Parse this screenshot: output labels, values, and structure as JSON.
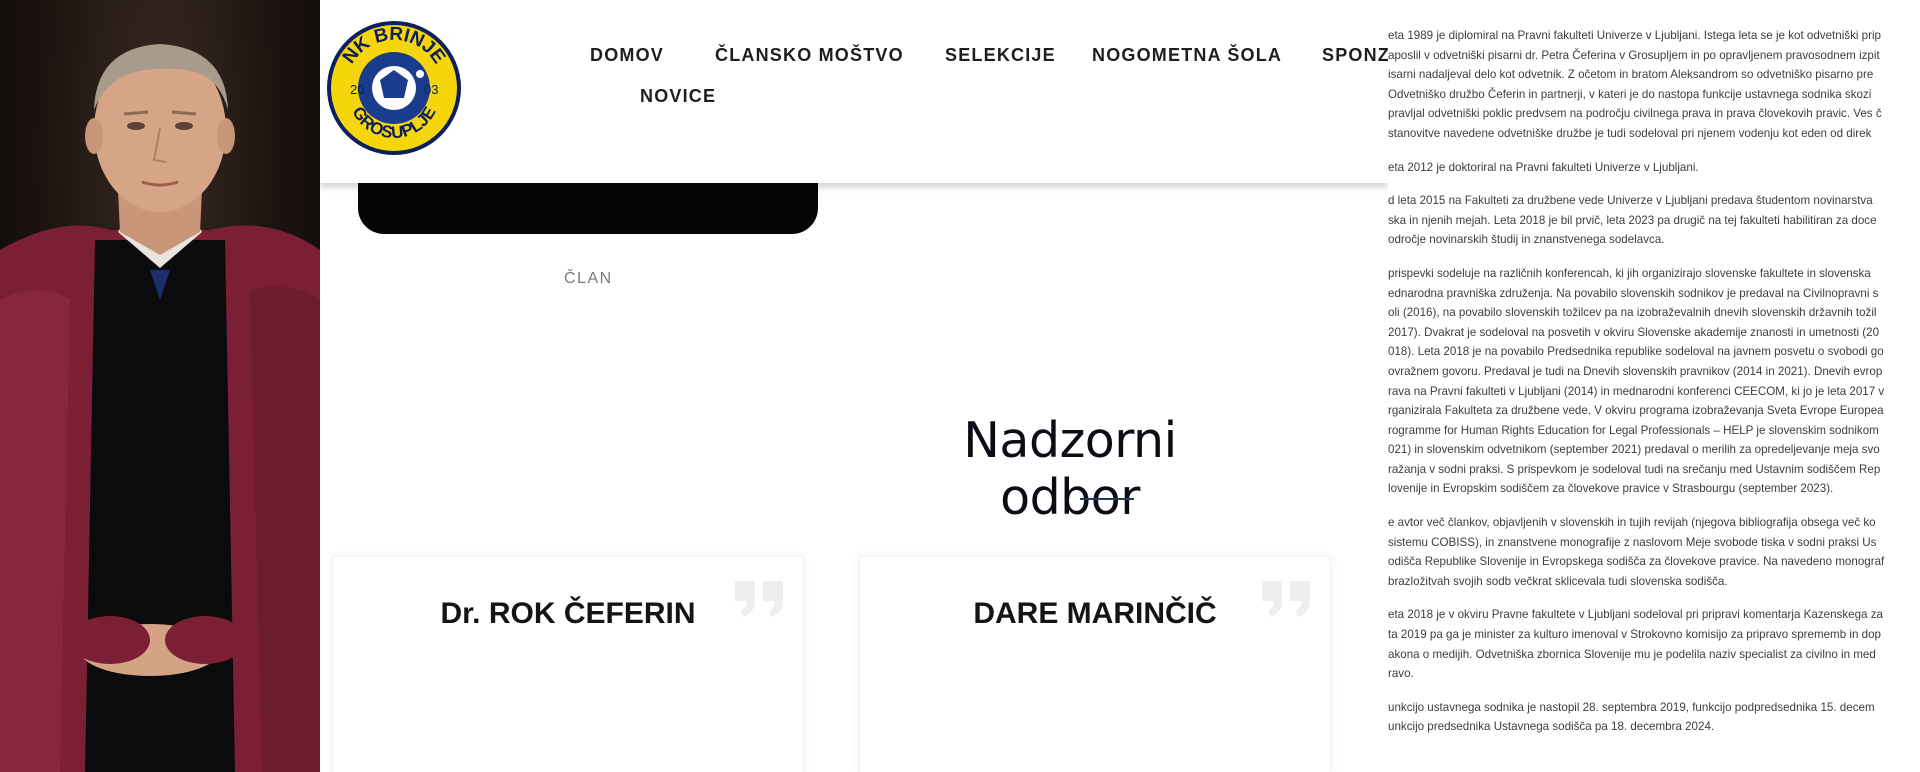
{
  "nav": {
    "items": [
      "DOMOV",
      "ČLANSKO MOŠTVO",
      "SELEKCIJE",
      "NOGOMETNA ŠOLA",
      "SPONZ",
      "NOVICE"
    ]
  },
  "logo": {
    "top_text": "NK BRINJE",
    "bottom_text": "GROSUPLJE",
    "year_left": "20",
    "year_right": "03",
    "colors": {
      "ring": "#f5d60a",
      "inner": "#1a3c8c",
      "text": "#0d1f5c"
    }
  },
  "member_above": {
    "role": "ČLAN"
  },
  "section": {
    "title": "Nadzorni odbor"
  },
  "members": [
    {
      "name": "Dr. ROK ČEFERIN"
    },
    {
      "name": "DARE MARINČIČ"
    }
  ],
  "document": {
    "paragraphs": [
      [
        "eta 1989 je diplomiral na Pravni fakulteti Univerze v Ljubljani. Istega leta se je kot odvetniški prip",
        "aposlil v odvetniški pisarni dr. Petra Čeferina v Grosupljem in po opravljenem pravosodnem izpit",
        "isarni nadaljeval delo kot odvetnik. Z očetom in bratom Aleksandrom so odvetniško pisarno pre",
        "Odvetniško družbo Čeferin in partnerji, v kateri je do nastopa funkcije ustavnega sodnika skozi",
        "pravljal odvetniški poklic predvsem na področju civilnega prava in prava človekovih pravic. Ves č",
        "stanovitve navedene odvetniške družbe je tudi sodeloval pri njenem vodenju kot eden od direk"
      ],
      [
        "eta 2012 je doktoriral na Pravni fakulteti Univerze v Ljubljani."
      ],
      [
        "d leta 2015 na Fakulteti za družbene vede Univerze v Ljubljani predava študentom novinarstva",
        "ska in njenih mejah. Leta 2018 je bil prvič, leta 2023 pa drugič na tej fakulteti habilitiran za doce",
        "odročje novinarskih študij in znanstvenega sodelavca."
      ],
      [
        "prispevki sodeluje na različnih konferencah, ki jih organizirajo slovenske fakultete in slovenska",
        "ednarodna pravniška združenja. Na povabilo slovenskih sodnikov je predaval na Civilnopravni s",
        "oli (2016), na povabilo slovenskih tožilcev pa na izobraževalnih dnevih slovenskih državnih tožil",
        "2017). Dvakrat je sodeloval na posvetih v okviru Slovenske akademije znanosti in umetnosti (20",
        "018). Leta 2018 je na povabilo Predsednika republike sodeloval na javnem posvetu o svobodi go",
        "ovražnem govoru. Predaval je tudi na Dnevih slovenskih pravnikov (2014 in 2021). Dnevih evrop",
        "rava na Pravni fakulteti v Ljubljani (2014) in mednarodni konferenci CEECOM, ki jo je leta 2017 v",
        "rganizirala Fakulteta za družbene vede. V okviru programa izobraževanja Sveta Evrope Europea",
        "rogramme for Human Rights Education for Legal Professionals – HELP je slovenskim sodnikom",
        "021) in slovenskim odvetnikom (september 2021) predaval o merilih za opredeljevanje meja svo",
        "ražanja v sodni praksi. S prispevkom je sodeloval tudi na srečanju med Ustavnim sodiščem Rep",
        "lovenije in Evropskim sodiščem za človekove pravice v Strasbourgu (september 2023)."
      ],
      [
        "e avtor več člankov, objavljenih v slovenskih in tujih revijah (njegova bibliografija obsega več ko",
        "sistemu COBISS), in znanstvene monografije z naslovom Meje svobode tiska v sodni praksi Us",
        "odišča Republike Slovenije in Evropskega sodišča za človekove pravice. Na navedeno monograf",
        "brazložitvah svojih sodb večkrat sklicevala tudi slovenska sodišča."
      ],
      [
        "eta 2018 je v okviru Pravne fakultete v Ljubljani sodeloval pri pripravi komentarja Kazenskega za",
        "ta 2019 pa ga je minister za kulturo imenoval v Strokovno komisijo za pripravo sprememb in dop",
        "akona o medijih. Odvetniška zbornica Slovenije mu je podelila naziv specialist za civilno in med",
        "ravo."
      ],
      [
        "unkcijo ustavnega sodnika je nastopil 28. septembra 2019, funkcijo podpredsednika 15. decem",
        "unkcijo predsednika Ustavnega sodišča pa 18. decembra 2024."
      ]
    ]
  }
}
